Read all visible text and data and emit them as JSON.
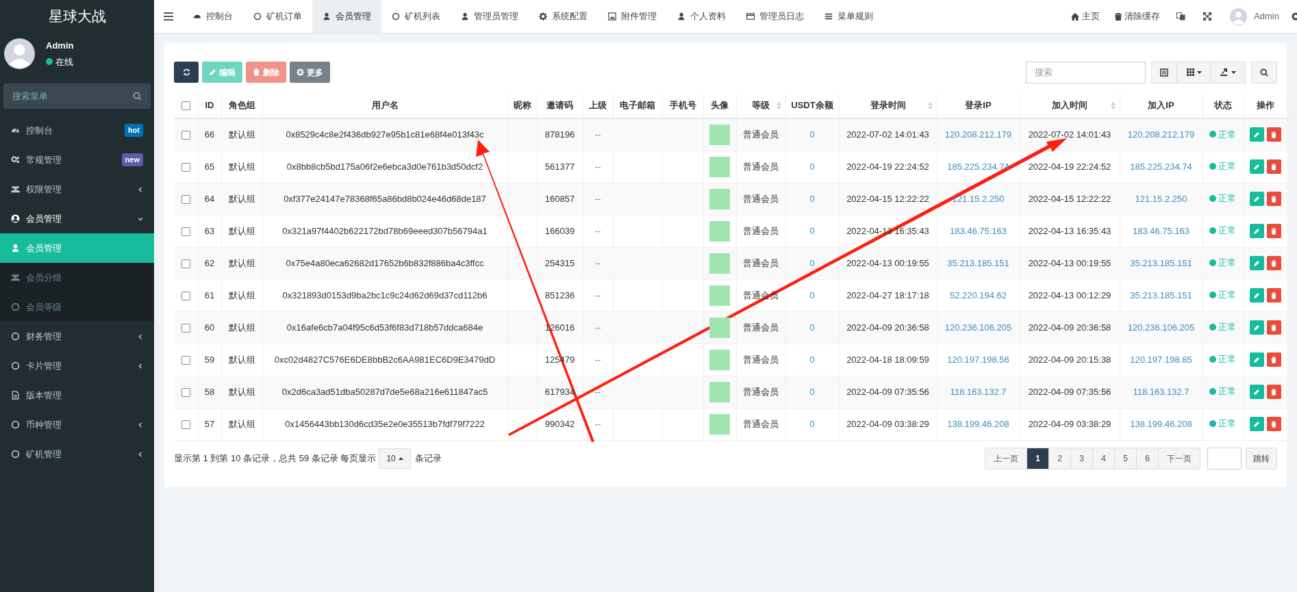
{
  "app_title": "星球大战",
  "user": {
    "name": "Admin",
    "status": "在线"
  },
  "sidebar": {
    "search": {
      "placeholder": "搜索菜单"
    },
    "items": [
      {
        "label": "控制台",
        "badge": "hot",
        "color": "#0073b7"
      },
      {
        "label": "常规管理",
        "badge": "new",
        "color": "#605ca8"
      },
      {
        "label": "权限管理",
        "expanded": false
      },
      {
        "label": "会员管理",
        "expanded": true,
        "children": [
          {
            "label": "会员管理",
            "selected": true
          },
          {
            "label": "会员分组",
            "selected": false
          },
          {
            "label": "会员等级",
            "selected": false
          }
        ]
      },
      {
        "label": "财务管理",
        "expanded": false
      },
      {
        "label": "卡片管理",
        "expanded": false
      },
      {
        "label": "版本管理"
      },
      {
        "label": "币种管理",
        "expanded": false
      },
      {
        "label": "矿机管理",
        "expanded": false
      }
    ]
  },
  "top_tabs": [
    {
      "label": "控制台",
      "selected": false
    },
    {
      "label": "矿机订单",
      "selected": false
    },
    {
      "label": "会员管理",
      "selected": true
    },
    {
      "label": "矿机列表",
      "selected": false
    },
    {
      "label": "管理员管理",
      "selected": false
    },
    {
      "label": "系统配置",
      "selected": false
    },
    {
      "label": "附件管理",
      "selected": false
    },
    {
      "label": "个人资料",
      "selected": false
    },
    {
      "label": "管理员日志",
      "selected": false
    },
    {
      "label": "菜单规则",
      "selected": false
    }
  ],
  "top_right": {
    "home": "主页",
    "clear_cache": "清除缓存",
    "user": "Admin"
  },
  "toolbar": {
    "buttons": [
      {
        "kind": "refresh",
        "disabled": false
      },
      {
        "kind": "edit",
        "label": "编辑",
        "disabled": true
      },
      {
        "kind": "delete",
        "label": "删除",
        "disabled": true
      },
      {
        "kind": "more",
        "label": "更多",
        "disabled": false
      }
    ],
    "search": {
      "placeholder": "搜索"
    }
  },
  "table": {
    "select_all_checked": false,
    "columns": [
      {
        "label": "ID",
        "sortable": false
      },
      {
        "label": "角色组",
        "sortable": false
      },
      {
        "label": "用户名",
        "sortable": false
      },
      {
        "label": "昵称",
        "sortable": false
      },
      {
        "label": "邀请码",
        "sortable": false
      },
      {
        "label": "上级",
        "sortable": false
      },
      {
        "label": "电子邮箱",
        "sortable": false
      },
      {
        "label": "手机号",
        "sortable": false
      },
      {
        "label": "头像",
        "sortable": false
      },
      {
        "label": "等级",
        "sortable": true
      },
      {
        "label": "USDT余额",
        "sortable": false
      },
      {
        "label": "登录时间",
        "sortable": true
      },
      {
        "label": "登录IP",
        "sortable": false
      },
      {
        "label": "加入时间",
        "sortable": true
      },
      {
        "label": "加入IP",
        "sortable": false
      },
      {
        "label": "状态",
        "sortable": false
      },
      {
        "label": "操作",
        "sortable": false
      }
    ],
    "rows": [
      {
        "checked": false,
        "id": "66",
        "group": "默认组",
        "username": "0x8529c4c8e2f436db927e95b1c81e68f4e013f43c",
        "invite_code": "878196",
        "parent": "--",
        "level": "普通会员",
        "usdt": "0",
        "login_time": "2022-07-02 14:01:43",
        "login_ip": "120.208.212.179",
        "join_time": "2022-07-02 14:01:43",
        "join_ip": "120.208.212.179",
        "status": "正常"
      },
      {
        "checked": false,
        "id": "65",
        "group": "默认组",
        "username": "0x8bb8cb5bd175a06f2e6ebca3d0e761b3d50dcf2",
        "invite_code": "561377",
        "parent": "--",
        "level": "普通会员",
        "usdt": "0",
        "login_time": "2022-04-19 22:24:52",
        "login_ip": "185.225.234.74",
        "join_time": "2022-04-19 22:24:52",
        "join_ip": "185.225.234.74",
        "status": "正常"
      },
      {
        "checked": false,
        "id": "64",
        "group": "默认组",
        "username": "0xf377e24147e78368f65a86bd8b024e46d68de187",
        "invite_code": "160857",
        "parent": "--",
        "level": "普通会员",
        "usdt": "0",
        "login_time": "2022-04-15 12:22:22",
        "login_ip": "121.15.2.250",
        "join_time": "2022-04-15 12:22:22",
        "join_ip": "121.15.2.250",
        "status": "正常"
      },
      {
        "checked": false,
        "id": "63",
        "group": "默认组",
        "username": "0x321a97f4402b622172bd78b69eeed307b56794a1",
        "invite_code": "166039",
        "parent": "--",
        "level": "普通会员",
        "usdt": "0",
        "login_time": "2022-04-13 16:35:43",
        "login_ip": "183.46.75.163",
        "join_time": "2022-04-13 16:35:43",
        "join_ip": "183.46.75.163",
        "status": "正常"
      },
      {
        "checked": false,
        "id": "62",
        "group": "默认组",
        "username": "0x75e4a80eca62682d17652b6b832f886ba4c3ffcc",
        "invite_code": "254315",
        "parent": "--",
        "level": "普通会员",
        "usdt": "0",
        "login_time": "2022-04-13 00:19:55",
        "login_ip": "35.213.185.151",
        "join_time": "2022-04-13 00:19:55",
        "join_ip": "35.213.185.151",
        "status": "正常"
      },
      {
        "checked": false,
        "id": "61",
        "group": "默认组",
        "username": "0x321893d0153d9ba2bc1c9c24d62d69d37cd112b6",
        "invite_code": "851236",
        "parent": "--",
        "level": "普通会员",
        "usdt": "0",
        "login_time": "2022-04-27 18:17:18",
        "login_ip": "52.220.194.62",
        "join_time": "2022-04-13 00:12:29",
        "join_ip": "35.213.185.151",
        "status": "正常"
      },
      {
        "checked": false,
        "id": "60",
        "group": "默认组",
        "username": "0x16afe6cb7a04f95c6d53f6f83d718b57ddca684e",
        "invite_code": "126016",
        "parent": "--",
        "level": "普通会员",
        "usdt": "0",
        "login_time": "2022-04-09 20:36:58",
        "login_ip": "120.236.106.205",
        "join_time": "2022-04-09 20:36:58",
        "join_ip": "120.236.106.205",
        "status": "正常"
      },
      {
        "checked": false,
        "id": "59",
        "group": "默认组",
        "username": "0xc02d4827C576E6DE8bbB2c6AA981EC6D9E3479dD",
        "invite_code": "125479",
        "parent": "--",
        "level": "普通会员",
        "usdt": "0",
        "login_time": "2022-04-18 18:09:59",
        "login_ip": "120.197.198.56",
        "join_time": "2022-04-09 20:15:38",
        "join_ip": "120.197.198.85",
        "status": "正常"
      },
      {
        "checked": false,
        "id": "58",
        "group": "默认组",
        "username": "0x2d6ca3ad51dba50287d7de5e68a216e611847ac5",
        "invite_code": "617934",
        "parent": "--",
        "level": "普通会员",
        "usdt": "0",
        "login_time": "2022-04-09 07:35:56",
        "login_ip": "118.163.132.7",
        "join_time": "2022-04-09 07:35:56",
        "join_ip": "118.163.132.7",
        "status": "正常"
      },
      {
        "checked": false,
        "id": "57",
        "group": "默认组",
        "username": "0x1456443bb130d6cd35e2e0e35513b7fdf79f7222",
        "invite_code": "990342",
        "parent": "--",
        "level": "普通会员",
        "usdt": "0",
        "login_time": "2022-04-09 03:38:29",
        "login_ip": "138.199.46.208",
        "join_time": "2022-04-09 03:38:29",
        "join_ip": "138.199.46.208",
        "status": "正常"
      }
    ]
  },
  "footer": {
    "summary": "显示第 1 到第 10 条记录，总共 59 条记录 每页显示",
    "page_size": "10",
    "page_size_suffix": "条记录"
  },
  "pagination": {
    "prev": "上一页",
    "pages": [
      {
        "label": "1",
        "selected": true
      },
      {
        "label": "2",
        "selected": false
      },
      {
        "label": "3",
        "selected": false
      },
      {
        "label": "4",
        "selected": false
      },
      {
        "label": "5",
        "selected": false
      },
      {
        "label": "6",
        "selected": false
      }
    ],
    "next": "下一页",
    "jump": "跳转"
  }
}
